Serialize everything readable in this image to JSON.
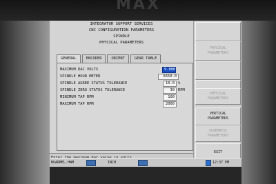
{
  "bezel": {
    "logo": "MAX"
  },
  "header": {
    "lines": [
      "INTEGRATOR SUPPORT SERVICES",
      "CNC CONFIGURATION PARAMETERS",
      "SPINDLE",
      "PHYSICAL PARAMETERS"
    ]
  },
  "tabs": [
    {
      "label": "GENERAL",
      "active": true
    },
    {
      "label": "ENCODER",
      "active": false
    },
    {
      "label": "ORIENT",
      "active": false
    },
    {
      "label": "GEAR TABLE",
      "active": false
    }
  ],
  "params": [
    {
      "label": "MAXIMUM DAC VOLTS",
      "value": "9.000",
      "unit": "",
      "selected": true
    },
    {
      "label": "SPINDLE HOUR METER",
      "value": "6650.0",
      "unit": "",
      "selected": false
    },
    {
      "label": "SPINDLE AGREE STATUS TOLERANCE",
      "value": "10.0",
      "unit": "%",
      "selected": false
    },
    {
      "label": "SPINDLE ZERO STATUS TOLERANCE",
      "value": "30",
      "unit": "RPM",
      "selected": false
    },
    {
      "label": "MINIMUM TAP RPM",
      "value": "100",
      "unit": "",
      "selected": false
    },
    {
      "label": "MAXIMUM TAP RPM",
      "value": "2000",
      "unit": "",
      "selected": false
    }
  ],
  "message": {
    "text": "Enter the maximum dac value in volts."
  },
  "side_buttons": [
    {
      "label": "",
      "disabled": false
    },
    {
      "label": "PHYSICAL\nPARAMETERS",
      "disabled": true
    },
    {
      "label": "",
      "disabled": false
    },
    {
      "label": "",
      "disabled": false
    },
    {
      "label": "PHYSICAL\nPARAMETERS",
      "disabled": true
    },
    {
      "label": "VERTICAL\nPARAMETERS",
      "disabled": false
    },
    {
      "label": "SCHEMATIC\nPARAMETERS",
      "disabled": true
    },
    {
      "label": "EXIT",
      "disabled": false
    }
  ],
  "taskbar": {
    "program": "BOARMEL.HWM",
    "units": "INCH",
    "time": "12:37 PM"
  }
}
